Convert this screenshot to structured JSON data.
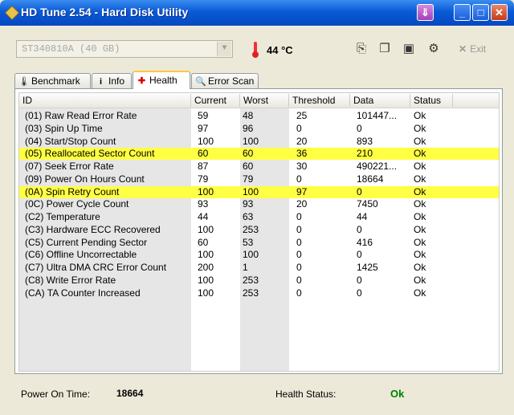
{
  "window": {
    "title": "HD Tune 2.54 - Hard Disk Utility"
  },
  "toolbar": {
    "drive": "ST340810A (40 GB)",
    "temperature": "44 °C",
    "exit_label": "Exit"
  },
  "tabs": [
    {
      "label": "Benchmark",
      "icon": "benchmark-icon"
    },
    {
      "label": "Info",
      "icon": "info-icon"
    },
    {
      "label": "Health",
      "icon": "health-cross-icon"
    },
    {
      "label": "Error Scan",
      "icon": "error-scan-icon"
    }
  ],
  "active_tab": "Health",
  "table": {
    "columns": [
      "ID",
      "Current",
      "Worst",
      "Threshold",
      "Data",
      "Status"
    ],
    "rows": [
      {
        "id": "(01) Raw Read Error Rate",
        "current": "59",
        "worst": "48",
        "threshold": "25",
        "data": "101447...",
        "status": "Ok",
        "warn": false
      },
      {
        "id": "(03) Spin Up Time",
        "current": "97",
        "worst": "96",
        "threshold": "0",
        "data": "0",
        "status": "Ok",
        "warn": false
      },
      {
        "id": "(04) Start/Stop Count",
        "current": "100",
        "worst": "100",
        "threshold": "20",
        "data": "893",
        "status": "Ok",
        "warn": false
      },
      {
        "id": "(05) Reallocated Sector Count",
        "current": "60",
        "worst": "60",
        "threshold": "36",
        "data": "210",
        "status": "Ok",
        "warn": true
      },
      {
        "id": "(07) Seek Error Rate",
        "current": "87",
        "worst": "60",
        "threshold": "30",
        "data": "490221...",
        "status": "Ok",
        "warn": false
      },
      {
        "id": "(09) Power On Hours Count",
        "current": "79",
        "worst": "79",
        "threshold": "0",
        "data": "18664",
        "status": "Ok",
        "warn": false
      },
      {
        "id": "(0A) Spin Retry Count",
        "current": "100",
        "worst": "100",
        "threshold": "97",
        "data": "0",
        "status": "Ok",
        "warn": true
      },
      {
        "id": "(0C) Power Cycle Count",
        "current": "93",
        "worst": "93",
        "threshold": "20",
        "data": "7450",
        "status": "Ok",
        "warn": false
      },
      {
        "id": "(C2) Temperature",
        "current": "44",
        "worst": "63",
        "threshold": "0",
        "data": "44",
        "status": "Ok",
        "warn": false
      },
      {
        "id": "(C3) Hardware ECC Recovered",
        "current": "100",
        "worst": "253",
        "threshold": "0",
        "data": "0",
        "status": "Ok",
        "warn": false
      },
      {
        "id": "(C5) Current Pending Sector",
        "current": "60",
        "worst": "53",
        "threshold": "0",
        "data": "416",
        "status": "Ok",
        "warn": false
      },
      {
        "id": "(C6) Offline Uncorrectable",
        "current": "100",
        "worst": "100",
        "threshold": "0",
        "data": "0",
        "status": "Ok",
        "warn": false
      },
      {
        "id": "(C7) Ultra DMA CRC Error Count",
        "current": "200",
        "worst": "1",
        "threshold": "0",
        "data": "1425",
        "status": "Ok",
        "warn": false
      },
      {
        "id": "(C8) Write Error Rate",
        "current": "100",
        "worst": "253",
        "threshold": "0",
        "data": "0",
        "status": "Ok",
        "warn": false
      },
      {
        "id": "(CA) TA Counter Increased",
        "current": "100",
        "worst": "253",
        "threshold": "0",
        "data": "0",
        "status": "Ok",
        "warn": false
      }
    ]
  },
  "status_bar": {
    "power_on_label": "Power On Time:",
    "power_on_value": "18664",
    "health_label": "Health Status:",
    "health_value": "Ok"
  },
  "colors": {
    "warning_row": "#ffff43",
    "health_ok": "#008000",
    "title_bar": "#0a5ad6"
  }
}
